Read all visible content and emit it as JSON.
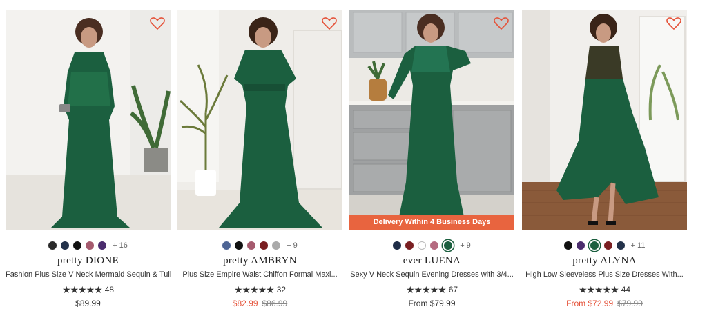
{
  "colors": {
    "accent": "#e5533a",
    "banner": "#e8643f",
    "dress_green": "#1b5f3f"
  },
  "products": [
    {
      "brand": "pretty DIONE",
      "title": "Fashion Plus Size V Neck Mermaid Sequin & Tull...",
      "rating_stars": "★★★★★",
      "rating_count": "48",
      "price": "$89.99",
      "sale_price": "",
      "original_price": "",
      "more_colors": "+ 16",
      "swatches": [
        "#2a2a2a",
        "#23324a",
        "#111111",
        "#a55a6e",
        "#4b2d6e"
      ],
      "selected_swatch": -1,
      "banner": ""
    },
    {
      "brand": "pretty AMBRYN",
      "title": "Plus Size Empire Waist Chiffon Formal Maxi...",
      "rating_stars": "★★★★★",
      "rating_count": "32",
      "price": "",
      "sale_price": "$82.99",
      "original_price": "$86.99",
      "more_colors": "+ 9",
      "swatches": [
        "#4e6595",
        "#111111",
        "#a55a6e",
        "#7a1f22",
        "#aaaaaa"
      ],
      "selected_swatch": -1,
      "banner": ""
    },
    {
      "brand": "ever LUENA",
      "title": "Sexy V Neck Sequin Evening Dresses with 3/4...",
      "rating_stars": "★★★★★",
      "rating_count": "67",
      "price": "From $79.99",
      "sale_price": "",
      "original_price": "",
      "more_colors": "+ 9",
      "swatches": [
        "#1f2d47",
        "#7a1f22",
        "#ffffff",
        "#b56a80",
        "#1b5f3f"
      ],
      "selected_swatch": 4,
      "banner": "Delivery Within 4 Business Days"
    },
    {
      "brand": "pretty ALYNA",
      "title": "High Low Sleeveless Plus Size Dresses With...",
      "rating_stars": "★★★★★",
      "rating_count": "44",
      "price": "",
      "sale_price": "From $72.99",
      "original_price": "$79.99",
      "more_colors": "+ 11",
      "swatches": [
        "#111111",
        "#4b2d6e",
        "#1b5f3f",
        "#7a1f22",
        "#23324a"
      ],
      "selected_swatch": 2,
      "banner": ""
    }
  ]
}
